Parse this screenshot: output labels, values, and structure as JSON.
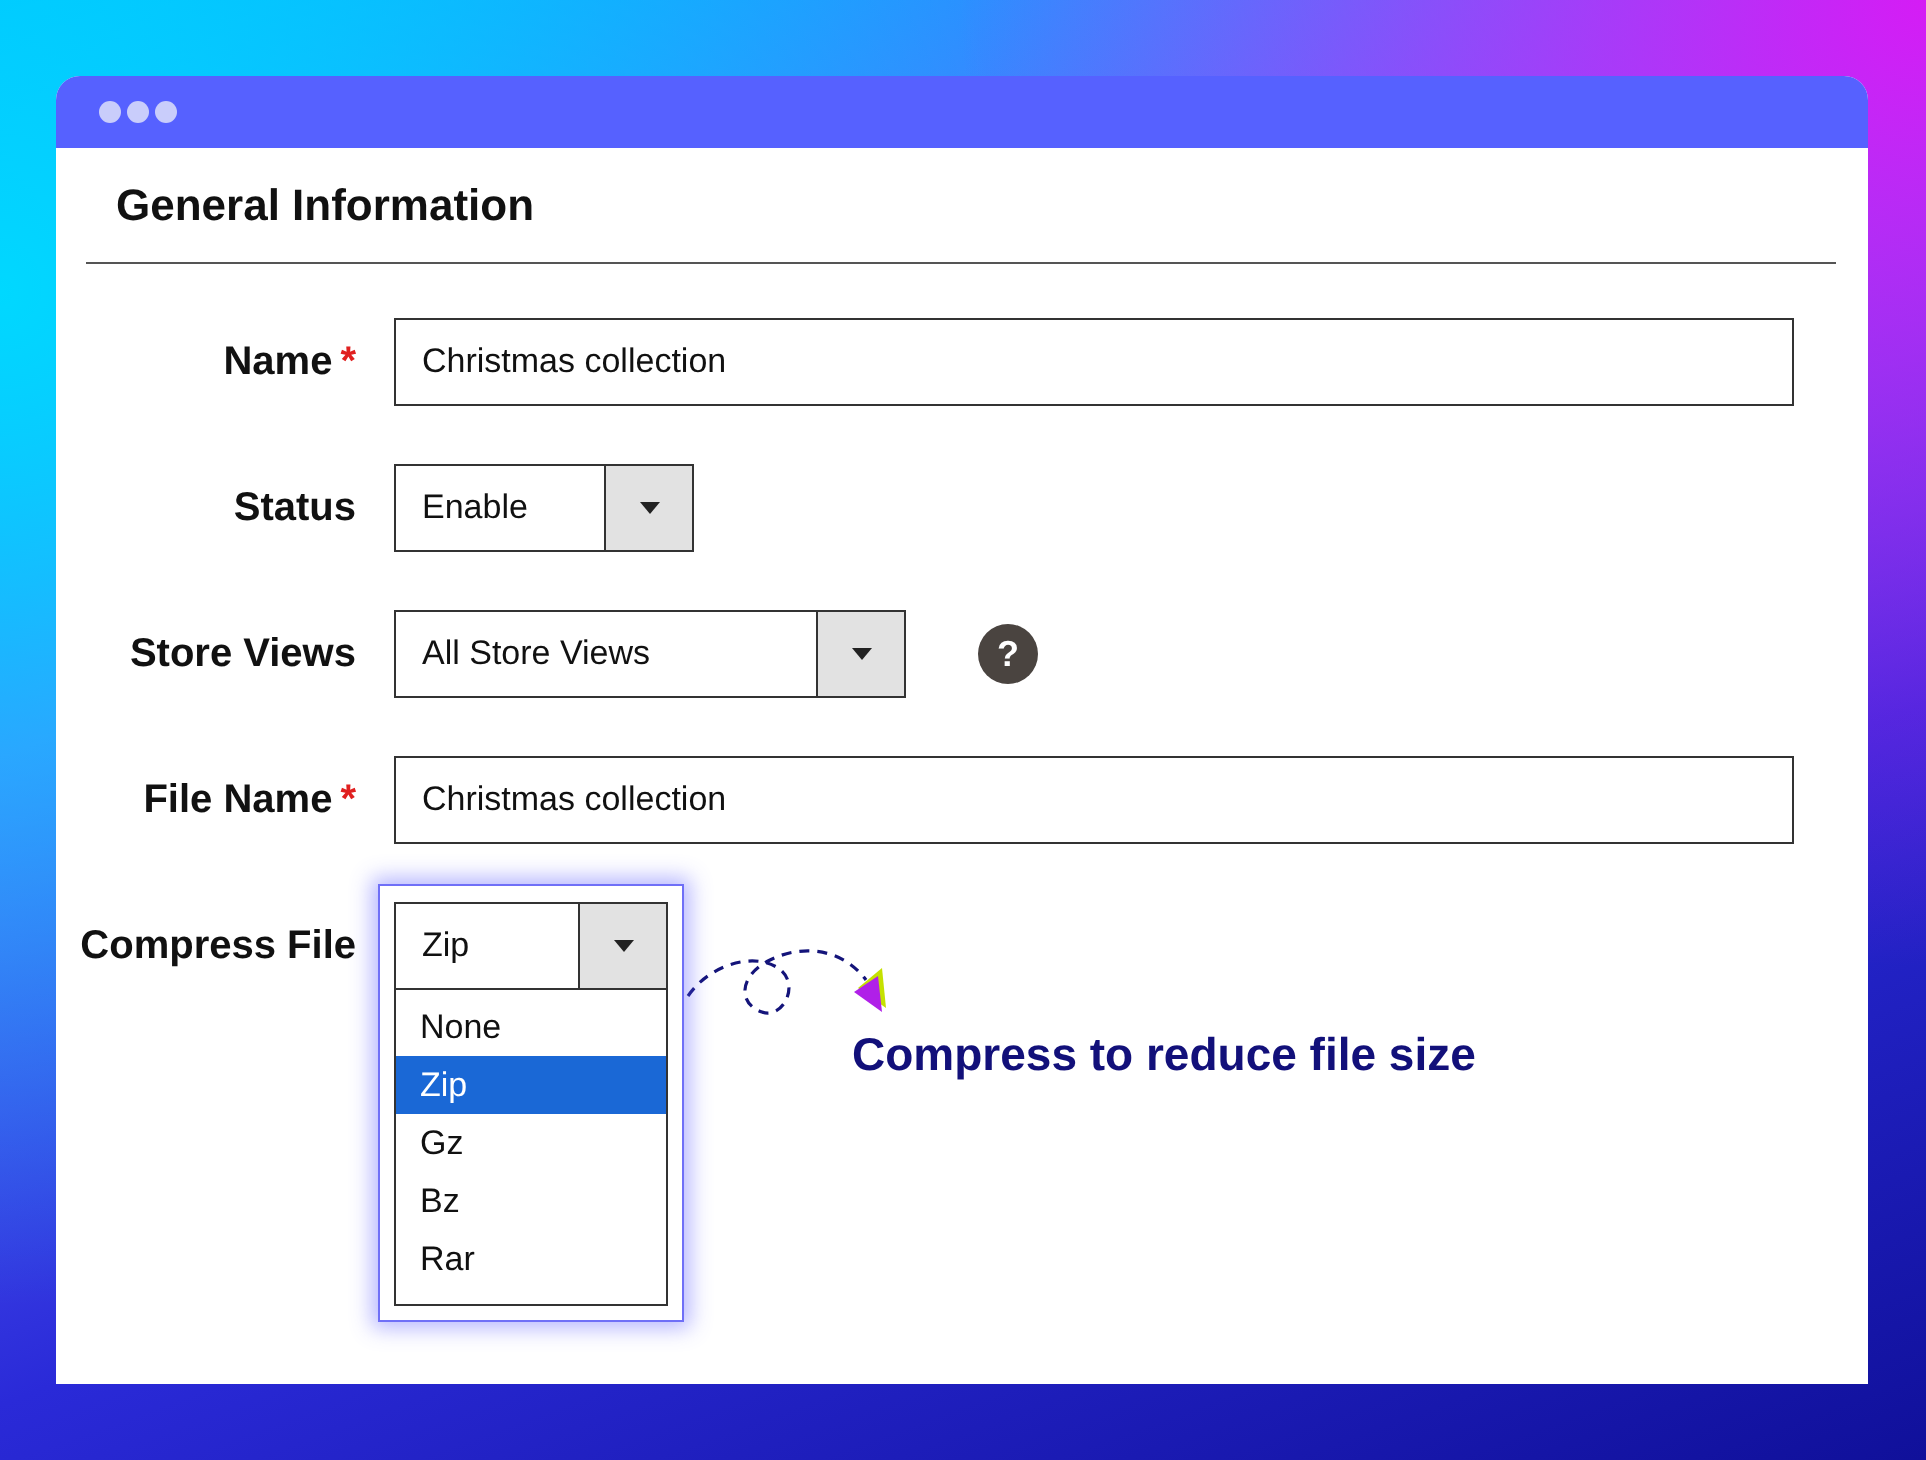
{
  "window": {
    "title": "General Information"
  },
  "fields": [
    {
      "label": "Name",
      "kind": "text",
      "required_mark": "*",
      "value": "Christmas collection"
    },
    {
      "label": "Status",
      "kind": "select",
      "value": "Enable"
    },
    {
      "label": "Store Views",
      "kind": "select",
      "value": "All Store Views",
      "help": "?"
    },
    {
      "label": "File Name",
      "kind": "text",
      "required_mark": "*",
      "value": "Christmas collection"
    },
    {
      "label": "Compress File",
      "kind": "select",
      "value": "Zip",
      "expanded": true,
      "options": [
        {
          "label": "None",
          "selected": false
        },
        {
          "label": "Zip",
          "selected": true
        },
        {
          "label": "Gz",
          "selected": false
        },
        {
          "label": "Bz",
          "selected": false
        },
        {
          "label": "Rar",
          "selected": false
        }
      ]
    }
  ],
  "annotation": "Compress to reduce file size"
}
